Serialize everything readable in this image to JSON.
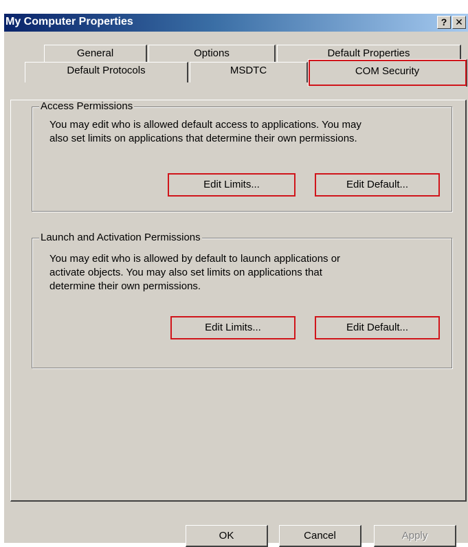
{
  "window": {
    "title": "My Computer Properties",
    "help_button": "?",
    "close_button": "✕"
  },
  "tabs_row1": [
    "General",
    "Options",
    "Default Properties"
  ],
  "tabs_row2": [
    "Default Protocols",
    "MSDTC",
    "COM Security"
  ],
  "active_tab": "COM Security",
  "access": {
    "title": "Access Permissions",
    "line1": "You may edit who is allowed default access to applications. You may",
    "line2": "also set limits on applications that determine their own permissions.",
    "edit_limits": "Edit Limits...",
    "edit_default": "Edit Default..."
  },
  "launch": {
    "title": "Launch and Activation Permissions",
    "line1": "You may edit who is allowed by default to launch applications or",
    "line2": "activate objects. You may also set limits on applications that",
    "line3": "determine their own permissions.",
    "edit_limits": "Edit Limits...",
    "edit_default": "Edit Default..."
  },
  "footer": {
    "ok": "OK",
    "cancel": "Cancel",
    "apply": "Apply"
  },
  "colors": {
    "highlight": "#d0141a",
    "titlebar_start": "#0a246a",
    "titlebar_end": "#a6caf0",
    "dialog_bg": "#d4d0c8"
  }
}
